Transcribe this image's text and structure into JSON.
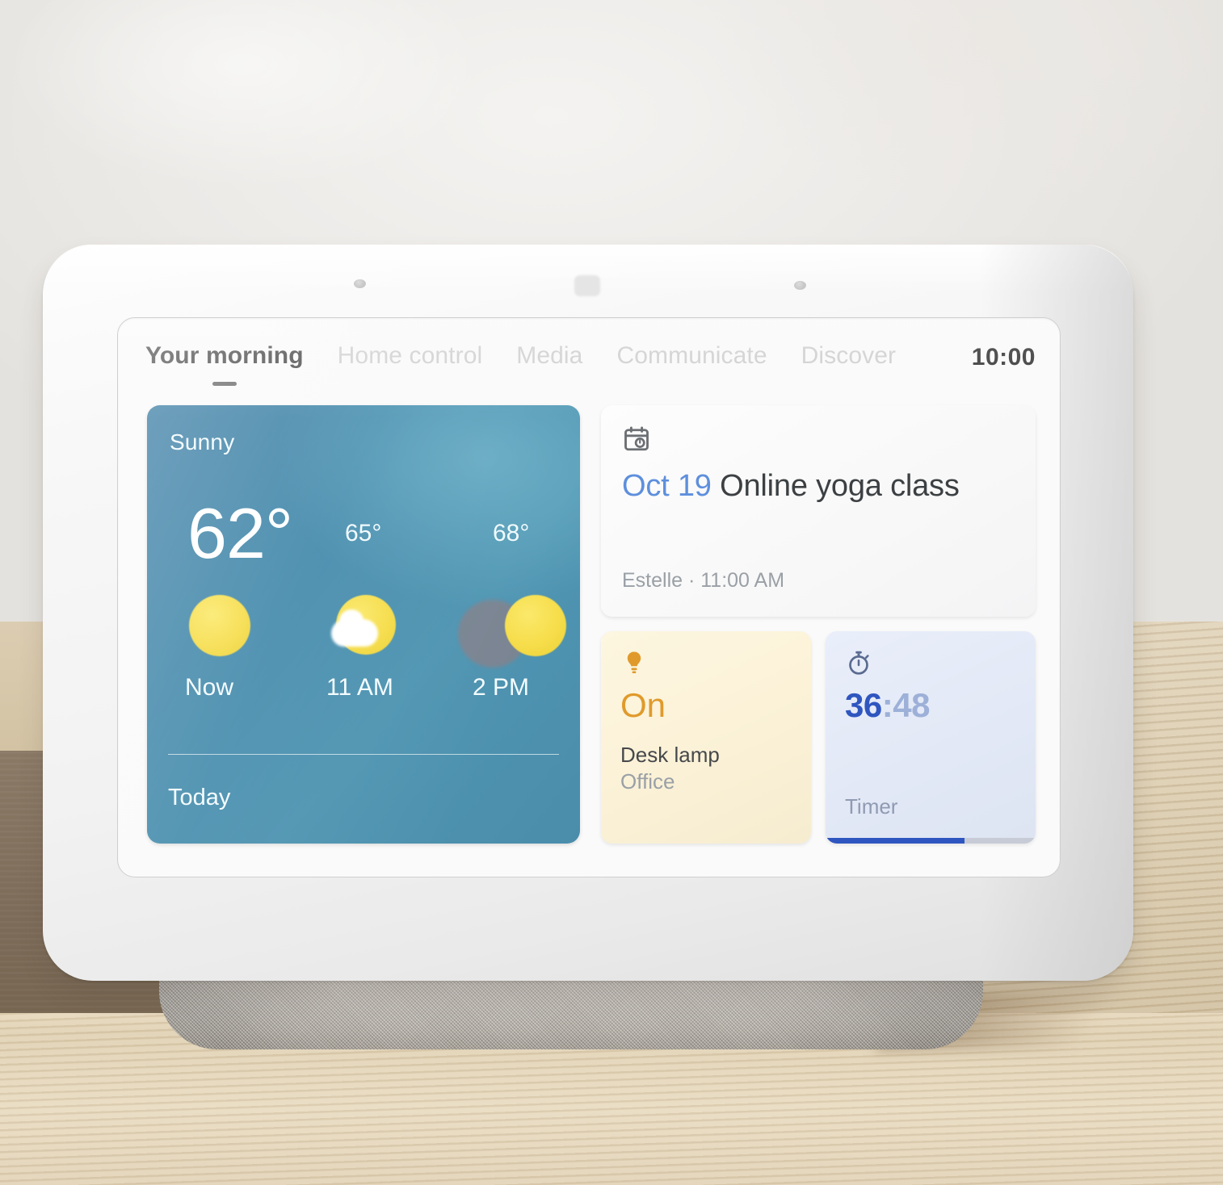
{
  "device": {
    "name": "smart-display",
    "clock": "10:00"
  },
  "nav": {
    "tabs": [
      {
        "label": "Your morning",
        "active": true
      },
      {
        "label": "Home control",
        "active": false
      },
      {
        "label": "Media",
        "active": false
      },
      {
        "label": "Communicate",
        "active": false
      },
      {
        "label": "Discover",
        "active": false
      }
    ]
  },
  "weather": {
    "condition": "Sunny",
    "current_temp": "62°",
    "footer_label": "Today",
    "forecast": [
      {
        "time": "Now",
        "temp": "",
        "icon": "sun-icon"
      },
      {
        "time": "11 AM",
        "temp": "65°",
        "icon": "sun-behind-cloud-icon"
      },
      {
        "time": "2 PM",
        "temp": "68°",
        "icon": "sun-behind-gray-cloud-icon"
      }
    ]
  },
  "calendar": {
    "icon": "calendar-clock-icon",
    "date": "Oct 19",
    "event_title": "Online yoga class",
    "subtitle": "Estelle · 11:00 AM"
  },
  "lamp": {
    "icon": "light-bulb-icon",
    "state": "On",
    "name": "Desk lamp",
    "room": "Office"
  },
  "timer": {
    "icon": "stopwatch-icon",
    "minutes": "36",
    "seconds": ":48",
    "label": "Timer",
    "progress_percent": 66
  },
  "colors": {
    "weather_card": "#4489ab",
    "calendar_date": "#5e8fdd",
    "lamp_accent": "#e09a2b",
    "timer_accent": "#2f56c0",
    "active_tab": "#4a4a4a",
    "inactive_tab": "#d2d2d2"
  }
}
